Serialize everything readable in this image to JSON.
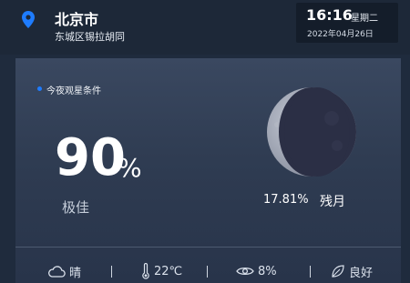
{
  "location": {
    "city": "北京市",
    "district": "东城区锡拉胡同"
  },
  "clock": {
    "time": "16:16",
    "weekday": "星期二",
    "date": "2022年04月26日"
  },
  "observation": {
    "title": "今夜观星条件",
    "percent": "90",
    "percent_sign": "%",
    "quality": "极佳",
    "illumination": "17.81%",
    "phase": "残月"
  },
  "weather": {
    "condition": "晴",
    "temperature": "22℃",
    "visibility": "8%",
    "air": "良好"
  },
  "colors": {
    "accent": "#1e7cff",
    "background": "#1f2b3d"
  }
}
